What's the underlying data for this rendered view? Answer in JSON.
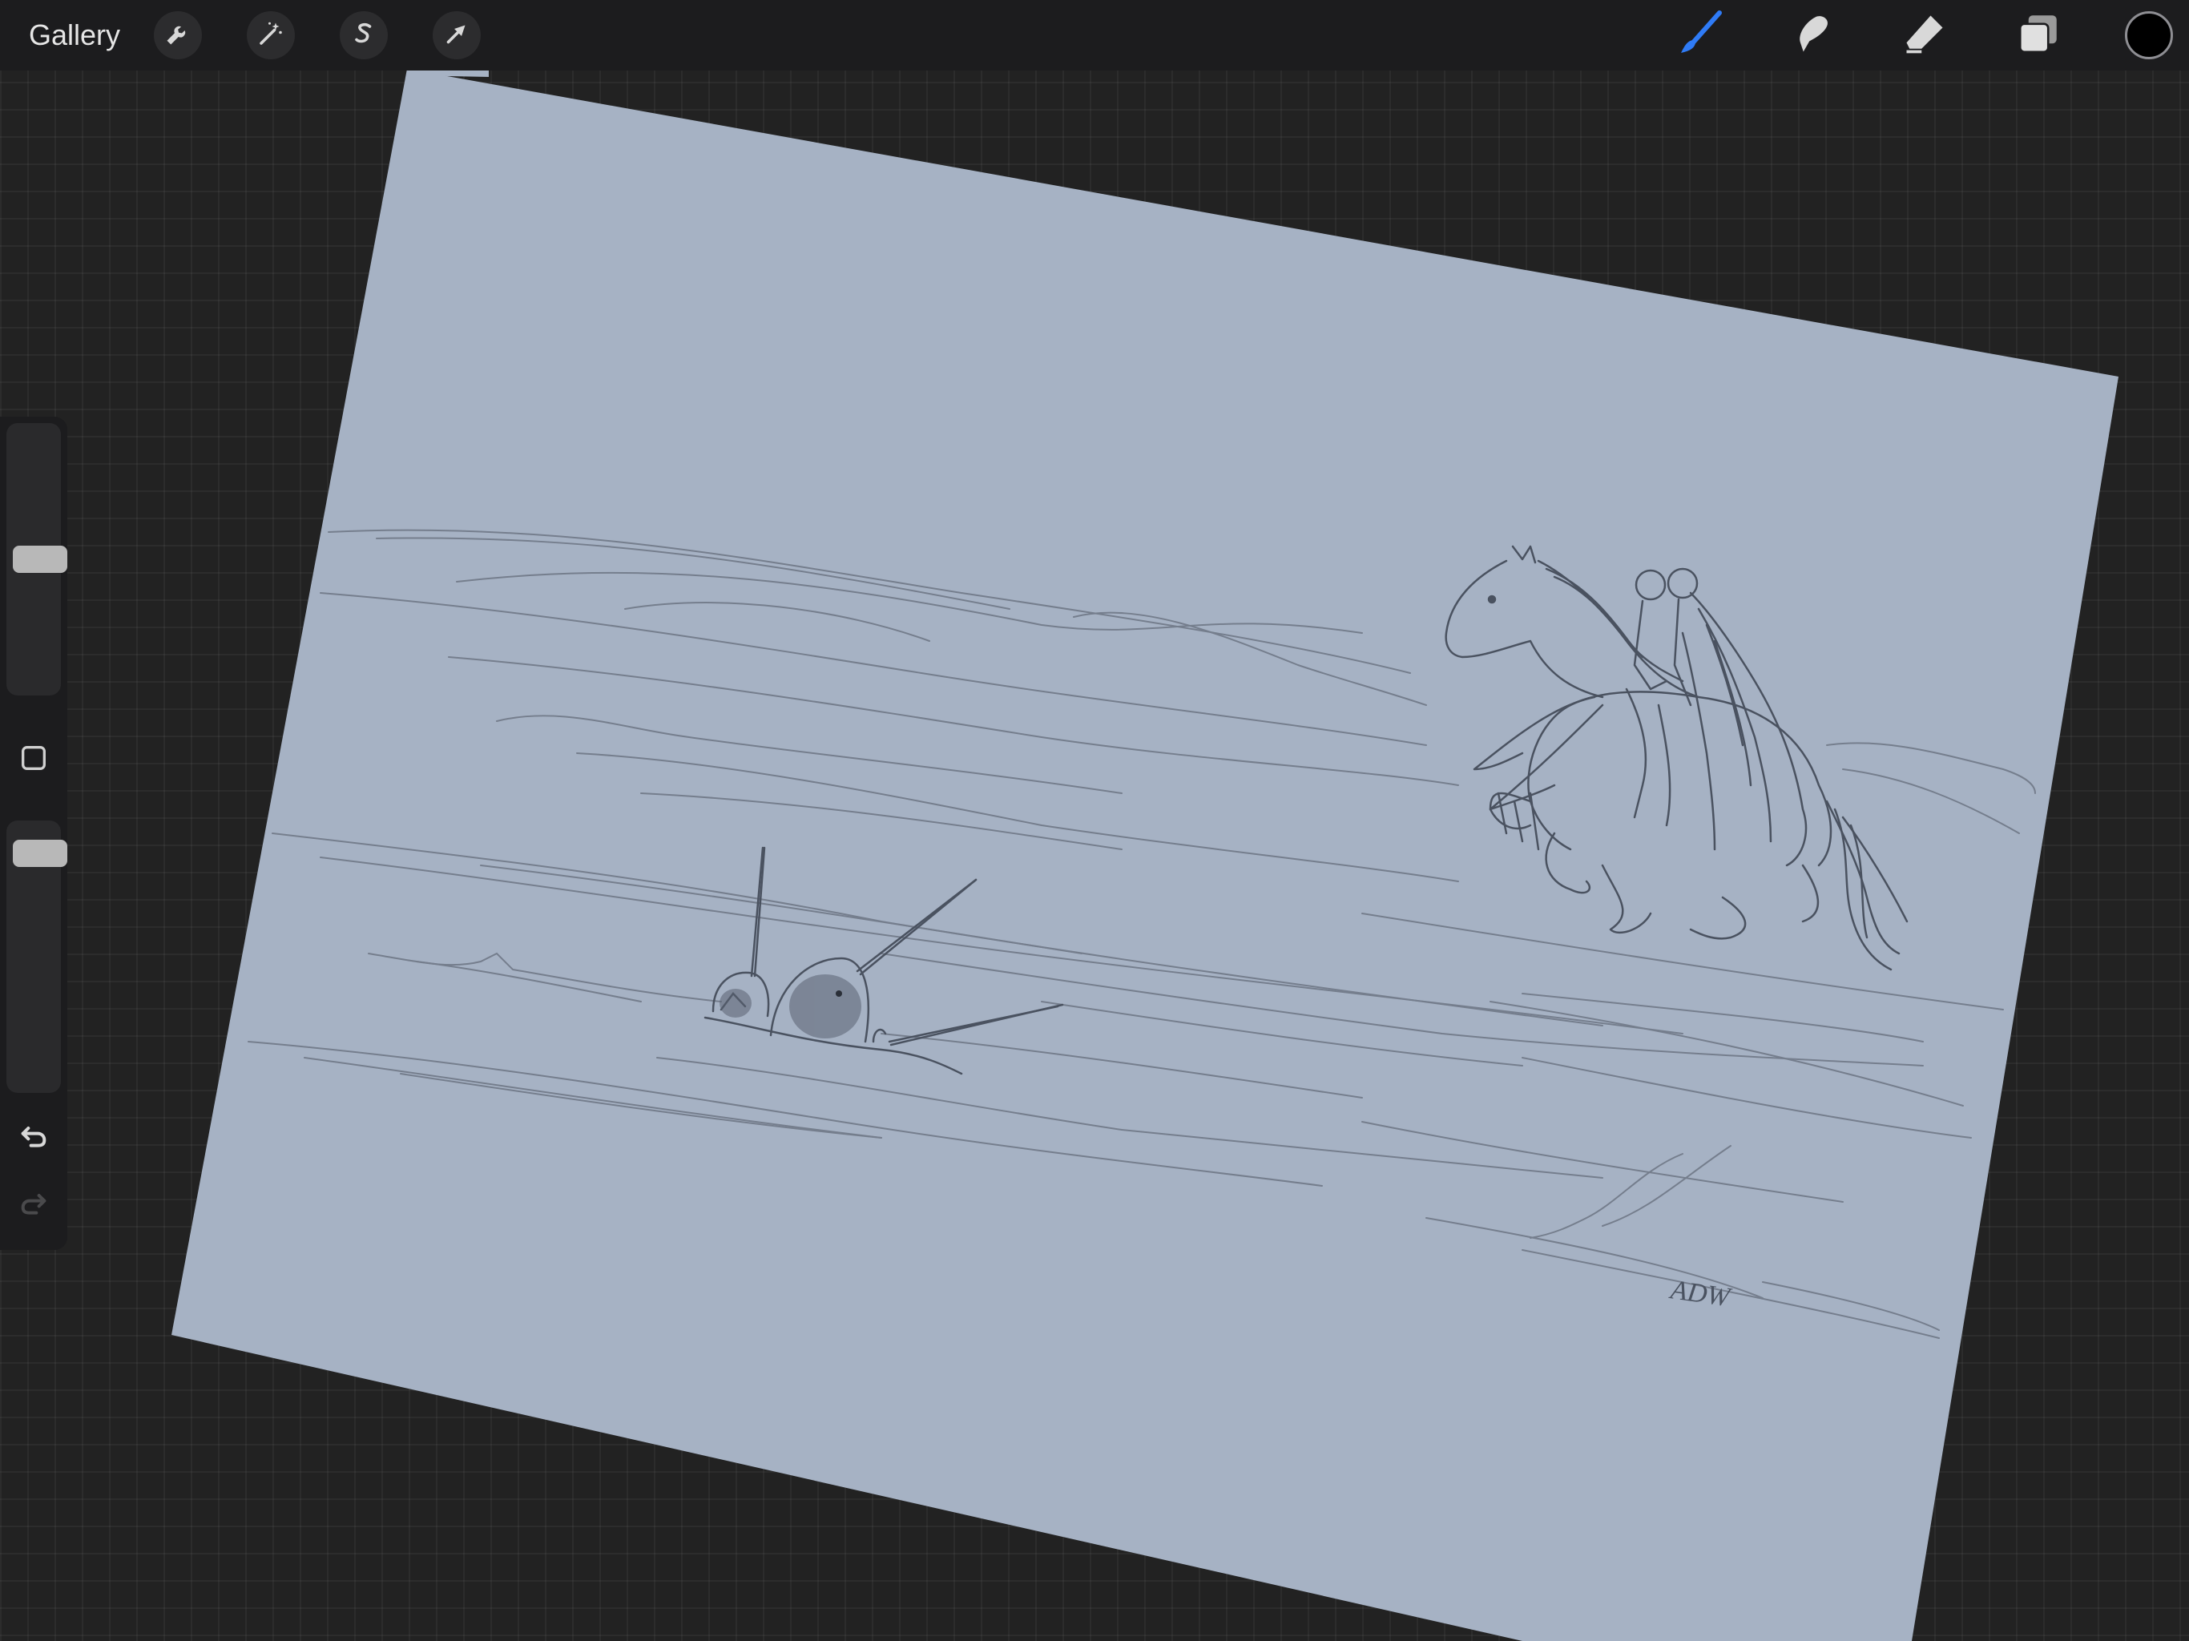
{
  "topbar": {
    "gallery_label": "Gallery",
    "left_tools": [
      "wrench-icon",
      "magic-wand-icon",
      "selection-icon",
      "transform-arrow-icon"
    ],
    "right_tools": [
      "brush-icon",
      "smudge-icon",
      "eraser-icon",
      "layers-icon"
    ],
    "active_tool": "brush",
    "current_color": "#000000",
    "accent_color": "#2f7bf6"
  },
  "sidebar": {
    "brush_size_level": 0.5,
    "opacity_level": 0.95,
    "undo_icon": "undo-icon",
    "redo_icon": "redo-icon",
    "modify_icon": "square-icon"
  },
  "canvas": {
    "paper_color": "#a6b2c4",
    "signature": "ADW"
  }
}
